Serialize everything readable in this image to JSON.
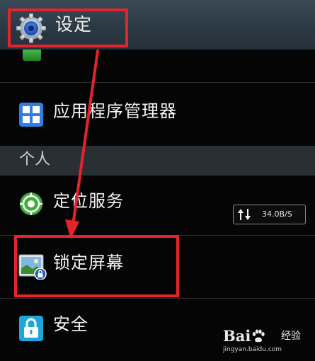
{
  "header": {
    "title": "设定",
    "icon": "gear-icon"
  },
  "rows": {
    "app_manager": {
      "label": "应用程序管理器",
      "icon": "grid-apps-icon"
    },
    "location": {
      "label": "定位服务",
      "icon": "location-target-icon"
    },
    "lock_screen": {
      "label": "锁定屏幕",
      "icon": "lock-screen-image-icon"
    },
    "security": {
      "label": "安全",
      "icon": "padlock-icon"
    }
  },
  "section": {
    "label": "个人"
  },
  "network_speed": {
    "value": "34.0B/S",
    "icon": "up-down-arrows-icon"
  },
  "annotation": {
    "highlight_color": "#e5232b"
  },
  "watermark": {
    "brand_left": "Bai",
    "brand_right": "经验",
    "url": "jingyan.baidu.com"
  }
}
